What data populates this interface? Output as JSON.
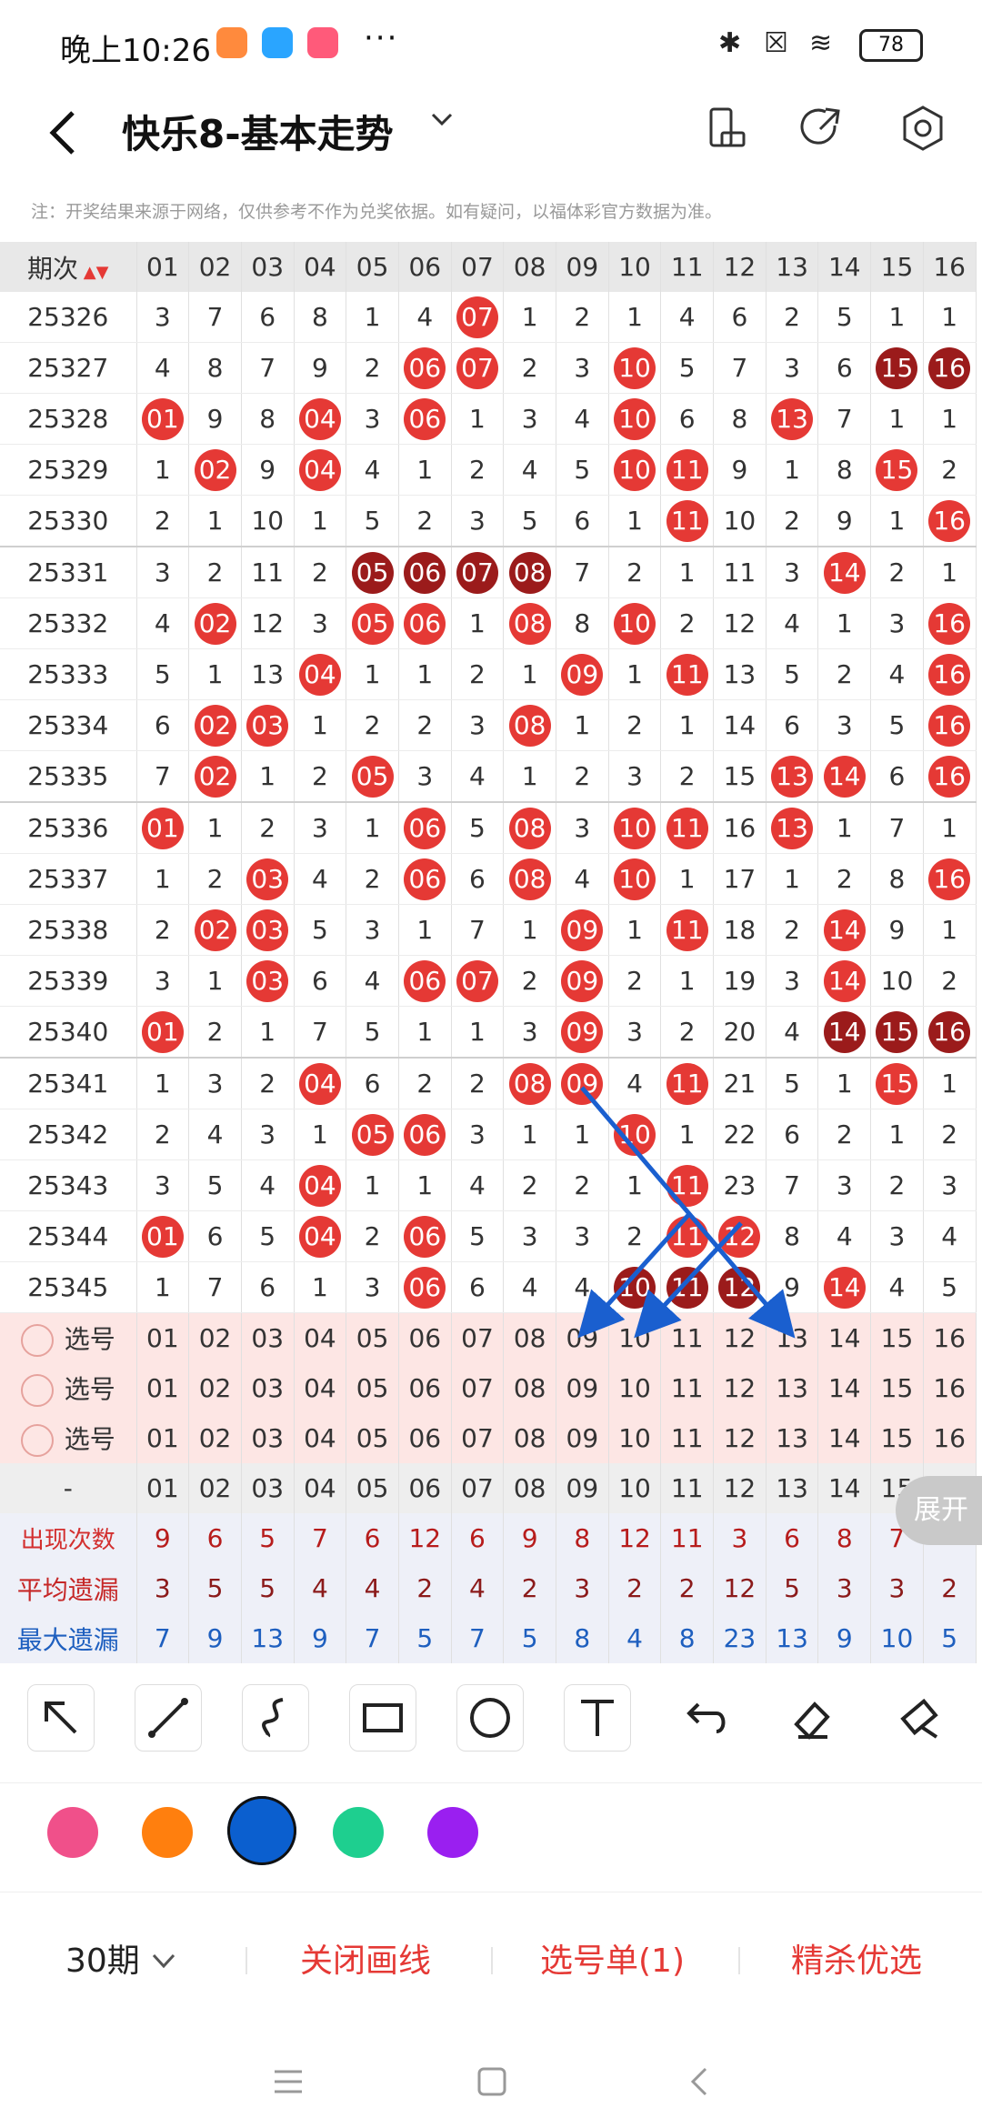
{
  "status_bar": {
    "time": "晚上10:26",
    "battery": "78",
    "dots": "···"
  },
  "header": {
    "title": "快乐8-基本走势",
    "back_icon": "chevron-left-icon",
    "title_dropdown_icon": "chevron-down-icon"
  },
  "notice": "注：开奖结果来源于网络，仅供参考不作为兑奖依据。如有疑问，以福体彩官方数据为准。",
  "grid": {
    "period_header": "期次",
    "columns": [
      "01",
      "02",
      "03",
      "04",
      "05",
      "06",
      "07",
      "08",
      "09",
      "10",
      "11",
      "12",
      "13",
      "14",
      "15",
      "16"
    ],
    "rows": [
      {
        "period": "25326",
        "cells": [
          "3",
          "7",
          "6",
          "8",
          "1",
          "4",
          "07",
          "1",
          "2",
          "1",
          "4",
          "6",
          "2",
          "5",
          "1",
          "1"
        ],
        "hit": [
          6
        ]
      },
      {
        "period": "25327",
        "cells": [
          "4",
          "8",
          "7",
          "9",
          "2",
          "06",
          "07",
          "2",
          "3",
          "10",
          "5",
          "7",
          "3",
          "6",
          "15",
          "16"
        ],
        "hit": [
          5,
          6,
          9
        ],
        "dark": [
          14,
          15
        ]
      },
      {
        "period": "25328",
        "cells": [
          "01",
          "9",
          "8",
          "04",
          "3",
          "06",
          "1",
          "3",
          "4",
          "10",
          "6",
          "8",
          "13",
          "7",
          "1",
          "1"
        ],
        "hit": [
          0,
          3,
          5,
          9,
          12
        ]
      },
      {
        "period": "25329",
        "cells": [
          "1",
          "02",
          "9",
          "04",
          "4",
          "1",
          "2",
          "4",
          "5",
          "10",
          "11",
          "9",
          "1",
          "8",
          "15",
          "2"
        ],
        "hit": [
          1,
          3,
          9,
          10,
          14
        ]
      },
      {
        "period": "25330",
        "cells": [
          "2",
          "1",
          "10",
          "1",
          "5",
          "2",
          "3",
          "5",
          "6",
          "1",
          "11",
          "10",
          "2",
          "9",
          "1",
          "16"
        ],
        "hit": [
          10,
          15
        ]
      },
      {
        "period": "25331",
        "cells": [
          "3",
          "2",
          "11",
          "2",
          "05",
          "06",
          "07",
          "08",
          "7",
          "2",
          "1",
          "11",
          "3",
          "14",
          "2",
          "1"
        ],
        "hit": [
          13
        ],
        "dark": [
          4,
          5,
          6,
          7
        ]
      },
      {
        "period": "25332",
        "cells": [
          "4",
          "02",
          "12",
          "3",
          "05",
          "06",
          "1",
          "08",
          "8",
          "10",
          "2",
          "12",
          "4",
          "1",
          "3",
          "16"
        ],
        "hit": [
          1,
          4,
          5,
          7,
          9,
          15
        ]
      },
      {
        "period": "25333",
        "cells": [
          "5",
          "1",
          "13",
          "04",
          "1",
          "1",
          "2",
          "1",
          "09",
          "1",
          "11",
          "13",
          "5",
          "2",
          "4",
          "16"
        ],
        "hit": [
          3,
          8,
          10,
          15
        ]
      },
      {
        "period": "25334",
        "cells": [
          "6",
          "02",
          "03",
          "1",
          "2",
          "2",
          "3",
          "08",
          "1",
          "2",
          "1",
          "14",
          "6",
          "3",
          "5",
          "16"
        ],
        "hit": [
          1,
          2,
          7,
          15
        ]
      },
      {
        "period": "25335",
        "cells": [
          "7",
          "02",
          "1",
          "2",
          "05",
          "3",
          "4",
          "1",
          "2",
          "3",
          "2",
          "15",
          "13",
          "14",
          "6",
          "16"
        ],
        "hit": [
          1,
          4,
          12,
          13,
          15
        ]
      },
      {
        "period": "25336",
        "cells": [
          "01",
          "1",
          "2",
          "3",
          "1",
          "06",
          "5",
          "08",
          "3",
          "10",
          "11",
          "16",
          "13",
          "1",
          "7",
          "1"
        ],
        "hit": [
          0,
          5,
          7,
          9,
          10,
          12
        ]
      },
      {
        "period": "25337",
        "cells": [
          "1",
          "2",
          "03",
          "4",
          "2",
          "06",
          "6",
          "08",
          "4",
          "10",
          "1",
          "17",
          "1",
          "2",
          "8",
          "16"
        ],
        "hit": [
          2,
          5,
          7,
          9,
          15
        ]
      },
      {
        "period": "25338",
        "cells": [
          "2",
          "02",
          "03",
          "5",
          "3",
          "1",
          "7",
          "1",
          "09",
          "1",
          "11",
          "18",
          "2",
          "14",
          "9",
          "1"
        ],
        "hit": [
          1,
          2,
          8,
          10,
          13
        ]
      },
      {
        "period": "25339",
        "cells": [
          "3",
          "1",
          "03",
          "6",
          "4",
          "06",
          "07",
          "2",
          "09",
          "2",
          "1",
          "19",
          "3",
          "14",
          "10",
          "2"
        ],
        "hit": [
          2,
          5,
          6,
          8,
          13
        ]
      },
      {
        "period": "25340",
        "cells": [
          "01",
          "2",
          "1",
          "7",
          "5",
          "1",
          "1",
          "3",
          "09",
          "3",
          "2",
          "20",
          "4",
          "14",
          "15",
          "16"
        ],
        "hit": [
          0,
          8
        ],
        "dark": [
          13,
          14,
          15
        ]
      },
      {
        "period": "25341",
        "cells": [
          "1",
          "3",
          "2",
          "04",
          "6",
          "2",
          "2",
          "08",
          "09",
          "4",
          "11",
          "21",
          "5",
          "1",
          "15",
          "1"
        ],
        "hit": [
          3,
          7,
          8,
          10,
          14
        ]
      },
      {
        "period": "25342",
        "cells": [
          "2",
          "4",
          "3",
          "1",
          "05",
          "06",
          "3",
          "1",
          "1",
          "10",
          "1",
          "22",
          "6",
          "2",
          "1",
          "2"
        ],
        "hit": [
          4,
          5,
          9
        ]
      },
      {
        "period": "25343",
        "cells": [
          "3",
          "5",
          "4",
          "04",
          "1",
          "1",
          "4",
          "2",
          "2",
          "1",
          "11",
          "23",
          "7",
          "3",
          "2",
          "3"
        ],
        "hit": [
          3,
          10
        ]
      },
      {
        "period": "25344",
        "cells": [
          "01",
          "6",
          "5",
          "04",
          "2",
          "06",
          "5",
          "3",
          "3",
          "2",
          "11",
          "12",
          "8",
          "4",
          "3",
          "4"
        ],
        "hit": [
          0,
          3,
          5,
          10,
          11
        ]
      },
      {
        "period": "25345",
        "cells": [
          "1",
          "7",
          "6",
          "1",
          "3",
          "06",
          "6",
          "4",
          "4",
          "10",
          "11",
          "12",
          "9",
          "14",
          "4",
          "5"
        ],
        "hit": [
          5,
          13
        ],
        "dark": [
          9,
          10,
          11
        ]
      }
    ],
    "select_label": "选号",
    "select_rows": 3,
    "stats_header_label": "-",
    "stats": [
      {
        "label": "出现次数",
        "values": [
          "9",
          "6",
          "5",
          "7",
          "6",
          "12",
          "6",
          "9",
          "8",
          "12",
          "11",
          "3",
          "6",
          "8",
          "7",
          ""
        ]
      },
      {
        "label": "平均遗漏",
        "values": [
          "3",
          "5",
          "5",
          "4",
          "4",
          "2",
          "4",
          "2",
          "3",
          "2",
          "2",
          "12",
          "5",
          "3",
          "3",
          "2"
        ]
      },
      {
        "label": "最大遗漏",
        "values": [
          "7",
          "9",
          "13",
          "9",
          "7",
          "5",
          "7",
          "5",
          "8",
          "4",
          "8",
          "23",
          "13",
          "9",
          "10",
          "5"
        ]
      }
    ],
    "expand_label": "展开"
  },
  "tools": [
    "arrow-tool-icon",
    "line-tool-icon",
    "curve-tool-icon",
    "rectangle-tool-icon",
    "circle-tool-icon",
    "text-tool-icon",
    "undo-icon",
    "eraser-icon",
    "clear-icon"
  ],
  "colors": [
    "#f0508a",
    "#ff7f0e",
    "#0b5fcf",
    "#1ecf8f",
    "#9a1ff0"
  ],
  "bottom_bar": {
    "period_select": "30期",
    "close_draw": "关闭画线",
    "pick_list": "选号单(1)",
    "best_pick": "精杀优选"
  }
}
